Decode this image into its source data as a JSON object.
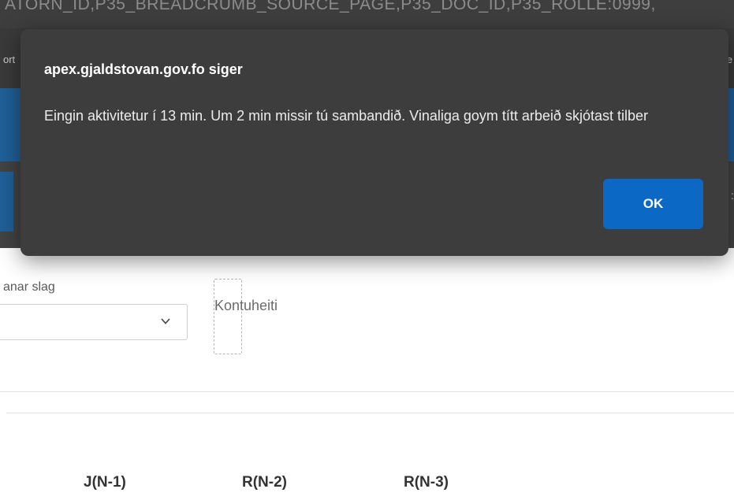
{
  "browser": {
    "url_fragment": "ATORN_ID,P35_BREADCRUMB_SOURCE_PAGE,P35_DOC_ID,P35_ROLLE:0999,",
    "bookmark_left": "ort",
    "bookmark_right": "e",
    "right_glyph": ":"
  },
  "form": {
    "type_label": "anar slag",
    "account_name_label": "Kontuheiti"
  },
  "table": {
    "columns": [
      "J(N-1)",
      "R(N-2)",
      "R(N-3)"
    ]
  },
  "dialog": {
    "title": "apex.gjaldstovan.gov.fo siger",
    "message": "Eingin aktivitetur í 13 min. Um 2 min missir tú sambandið. Vinaliga goym títt arbeið skjótast tilber",
    "ok_label": "OK"
  },
  "colors": {
    "dialog_bg": "#3d3d3d",
    "ok_button": "#0b68c5",
    "app_blue": "#205f98"
  }
}
